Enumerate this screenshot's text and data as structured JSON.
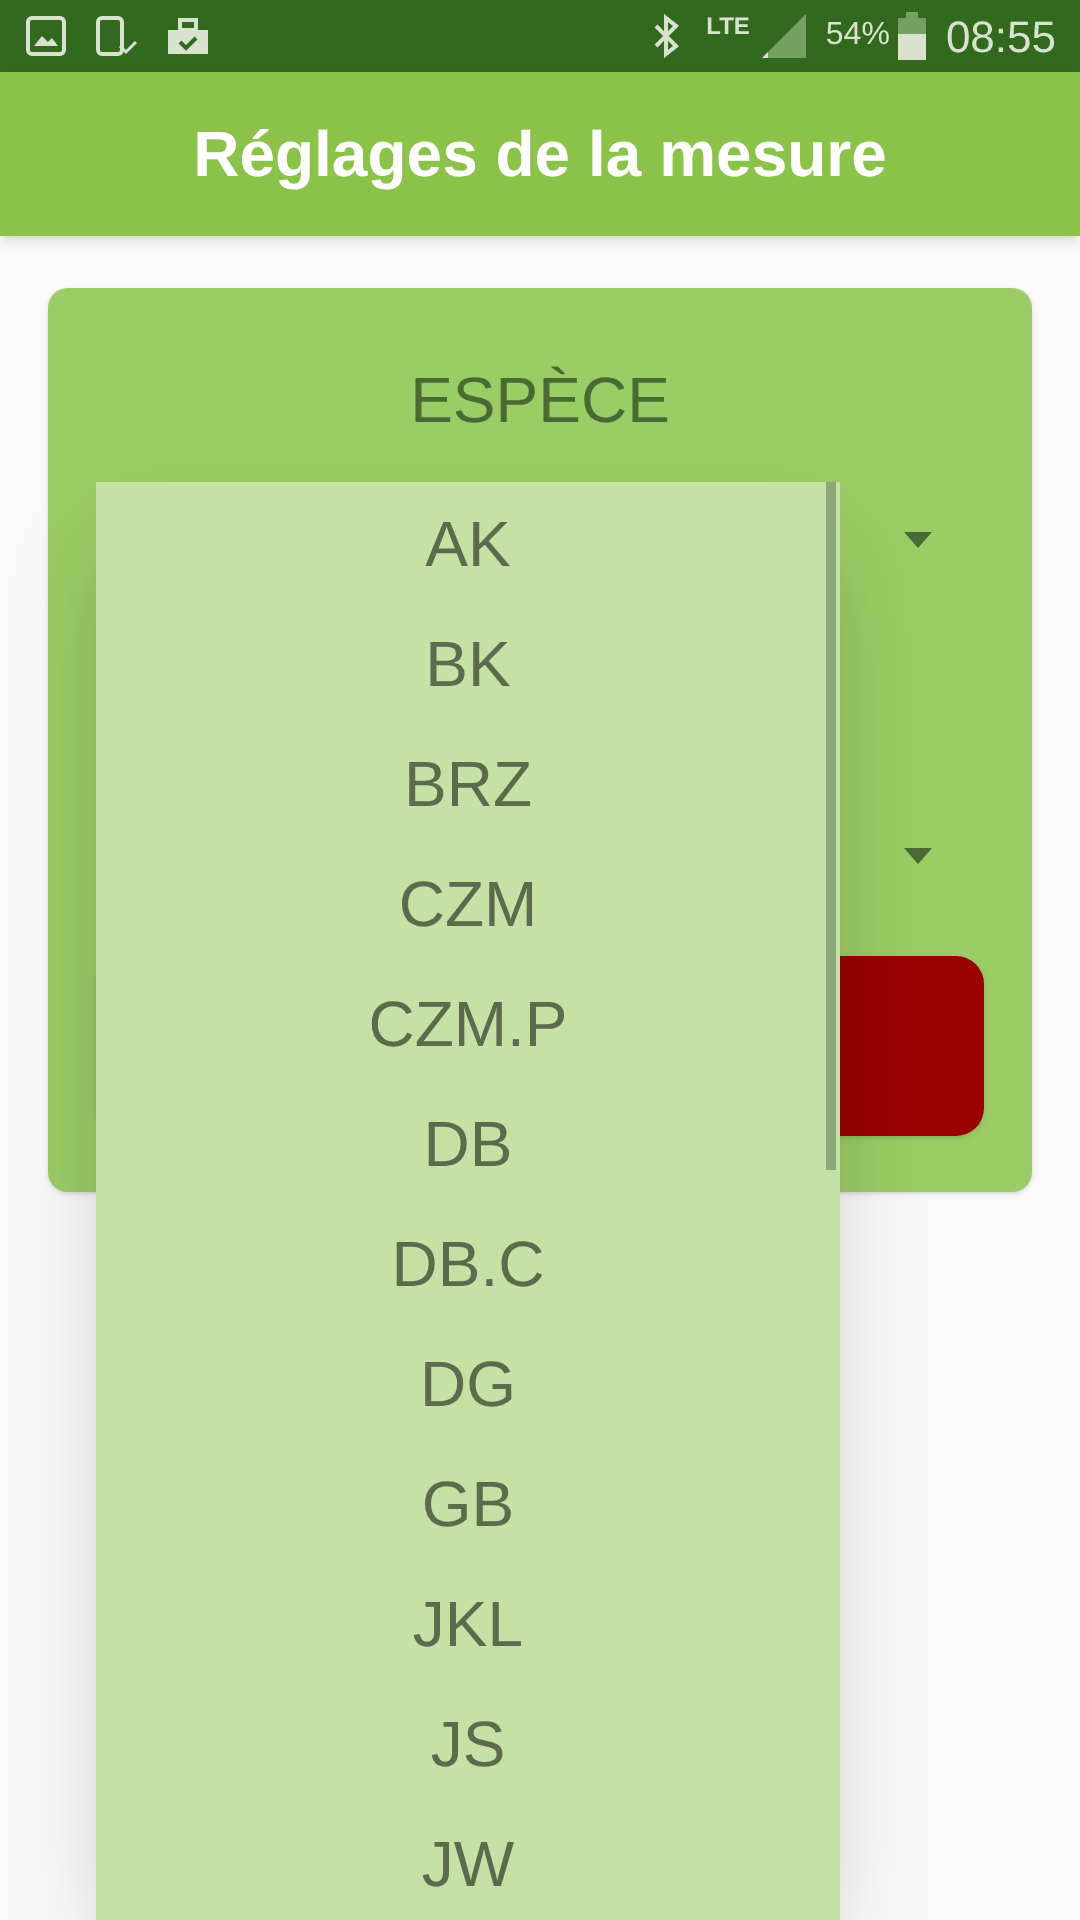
{
  "status_bar": {
    "network": "LTE",
    "battery": "54%",
    "time": "08:55"
  },
  "app_bar": {
    "title": "Réglages de la mesure"
  },
  "card": {
    "title": "ESPÈCE"
  },
  "dropdown": {
    "items": [
      {
        "label": "AK"
      },
      {
        "label": "BK"
      },
      {
        "label": "BRZ"
      },
      {
        "label": "CZM"
      },
      {
        "label": "CZM.P"
      },
      {
        "label": "DB"
      },
      {
        "label": "DB.C"
      },
      {
        "label": "DG"
      },
      {
        "label": "GB"
      },
      {
        "label": "JKL"
      },
      {
        "label": "JS"
      },
      {
        "label": "JW"
      }
    ]
  }
}
